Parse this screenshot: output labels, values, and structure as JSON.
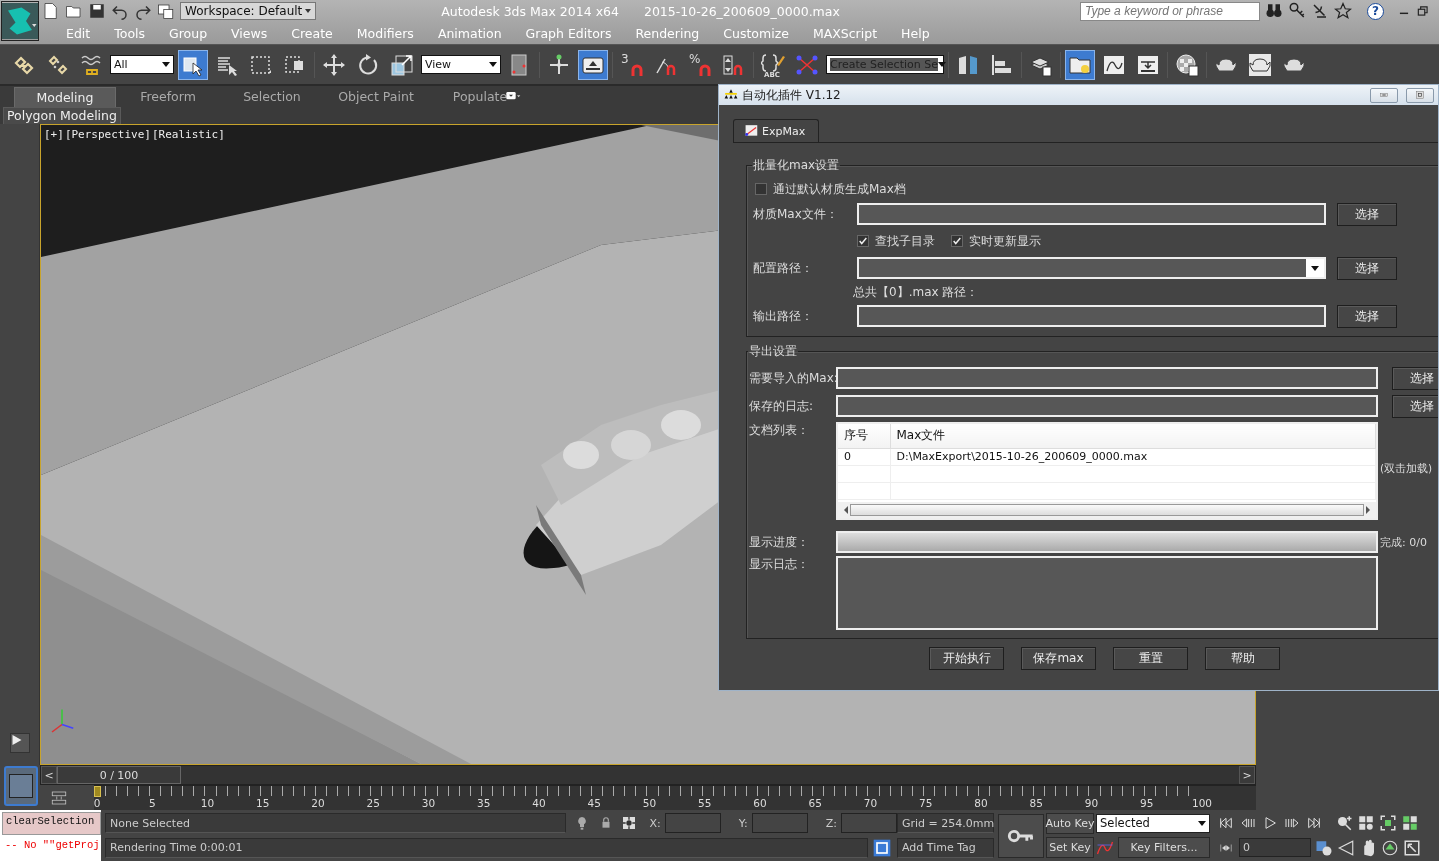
{
  "app": {
    "product": "Autodesk 3ds Max  2014 x64",
    "file": "2015-10-26_200609_0000.max",
    "workspace": "Workspace: Default",
    "search": {
      "placeholder": "Type a keyword or phrase"
    },
    "help": "?"
  },
  "menu": [
    "Edit",
    "Tools",
    "Group",
    "Views",
    "Create",
    "Modifiers",
    "Animation",
    "Graph Editors",
    "Rendering",
    "Customize",
    "MAXScript",
    "Help"
  ],
  "toolbar": [
    {
      "kind": "link",
      "active": false
    },
    {
      "kind": "unlink",
      "active": false
    },
    {
      "kind": "bind",
      "active": false
    },
    {
      "kind": "dropdown",
      "value": "All"
    },
    {
      "kind": "select",
      "active": true
    },
    {
      "kind": "select-list",
      "active": false
    },
    {
      "kind": "region",
      "active": false
    },
    {
      "kind": "crossing",
      "active": false
    },
    {
      "kind": "separator"
    },
    {
      "kind": "move",
      "active": false
    },
    {
      "kind": "rotate",
      "active": false
    },
    {
      "kind": "scale",
      "active": false
    },
    {
      "kind": "dropdown",
      "value": "View"
    },
    {
      "kind": "pivot",
      "active": false
    },
    {
      "kind": "separator"
    },
    {
      "kind": "manipulate",
      "active": false
    },
    {
      "kind": "shortcut",
      "active": true
    },
    {
      "kind": "separator"
    },
    {
      "kind": "snap",
      "label": "3",
      "active": false
    },
    {
      "kind": "angle-snap",
      "active": false
    },
    {
      "kind": "snap",
      "label": "%",
      "active": false
    },
    {
      "kind": "spinner-snap",
      "active": false
    },
    {
      "kind": "separator"
    },
    {
      "kind": "named-sets",
      "label": "ABC",
      "active": false
    },
    {
      "kind": "nodes",
      "active": false
    },
    {
      "kind": "dropdown",
      "value": "Create Selection Se"
    },
    {
      "kind": "separator"
    },
    {
      "kind": "mirror",
      "active": false
    },
    {
      "kind": "align",
      "active": false
    },
    {
      "kind": "separator"
    },
    {
      "kind": "layers",
      "active": false
    },
    {
      "kind": "separator"
    },
    {
      "kind": "explorer",
      "active": true
    },
    {
      "kind": "curve",
      "active": false
    },
    {
      "kind": "schematic",
      "active": false
    },
    {
      "kind": "separator"
    },
    {
      "kind": "material",
      "active": false
    },
    {
      "kind": "separator"
    },
    {
      "kind": "teapot",
      "active": false
    },
    {
      "kind": "teapot-frame",
      "active": false
    },
    {
      "kind": "teapot",
      "active": false
    }
  ],
  "ribbon": {
    "tabs": [
      {
        "label": "Modeling",
        "selected": true
      },
      {
        "label": "Freeform",
        "selected": false
      },
      {
        "label": "Selection",
        "selected": false
      },
      {
        "label": "Object Paint",
        "selected": false
      },
      {
        "label": "Populate",
        "selected": false
      }
    ],
    "panel": "Polygon Modeling"
  },
  "viewport": {
    "labels": [
      "[+]",
      "[Perspective]",
      "[Realistic]"
    ]
  },
  "timeline": {
    "prev": "<",
    "position": "0 / 100",
    "next": ">",
    "ticks": [
      "0",
      "5",
      "10",
      "15",
      "20",
      "25",
      "30",
      "35",
      "40",
      "45",
      "50",
      "55",
      "60",
      "65",
      "70",
      "75",
      "80",
      "85",
      "90",
      "95",
      "100"
    ]
  },
  "status": {
    "listener": [
      {
        "kind": "command",
        "text": "clearSelection"
      },
      {
        "kind": "error",
        "text": "-- No \"\"getProj"
      }
    ],
    "selection": "None Selected",
    "render_time": "Rendering Time  0:00:01",
    "coords": [
      "X:",
      "Y:",
      "Z:"
    ],
    "grid": "Grid = 254.0mm",
    "time_tag": "Add Time Tag",
    "auto_key": "Auto Key",
    "set_key": "Set Key",
    "key_mode": "Selected",
    "key_filters": "Key Filters...",
    "frame": "0"
  },
  "dialog": {
    "title": "自动化插件 V1.12",
    "tab": "ExpMax",
    "batch": {
      "legend": "批量化max设置",
      "use_default": {
        "label": "通过默认材质生成Max档",
        "checked": false
      },
      "material_file": {
        "label": "材质Max文件：",
        "button": "选择"
      },
      "options": [
        {
          "label": "查找子目录",
          "checked": true
        },
        {
          "label": "实时更新显示",
          "checked": true
        }
      ],
      "config_path": {
        "label": "配置路径：",
        "button": "选择"
      },
      "total": "总共【0】.max  路径：",
      "output_path": {
        "label": "输出路径：",
        "button": "选择"
      }
    },
    "export": {
      "legend": "导出设置",
      "import_max": {
        "label": "需要导入的Max:",
        "button": "选择"
      },
      "save_log": {
        "label": "保存的日志:",
        "button": "选择"
      },
      "doc_list": {
        "label": "文档列表：",
        "columns": [
          "序号",
          "Max文件"
        ],
        "rows": [
          [
            "0",
            "D:\\MaxExport\\2015-10-26_200609_0000.max"
          ]
        ],
        "hint": "(双击加载)"
      },
      "progress": {
        "label": "显示进度：",
        "level": 0,
        "status": "完成: 0/0"
      },
      "log": {
        "label": "显示日志："
      }
    },
    "buttons": [
      "开始执行",
      "保存max",
      "重置",
      "帮助"
    ]
  }
}
